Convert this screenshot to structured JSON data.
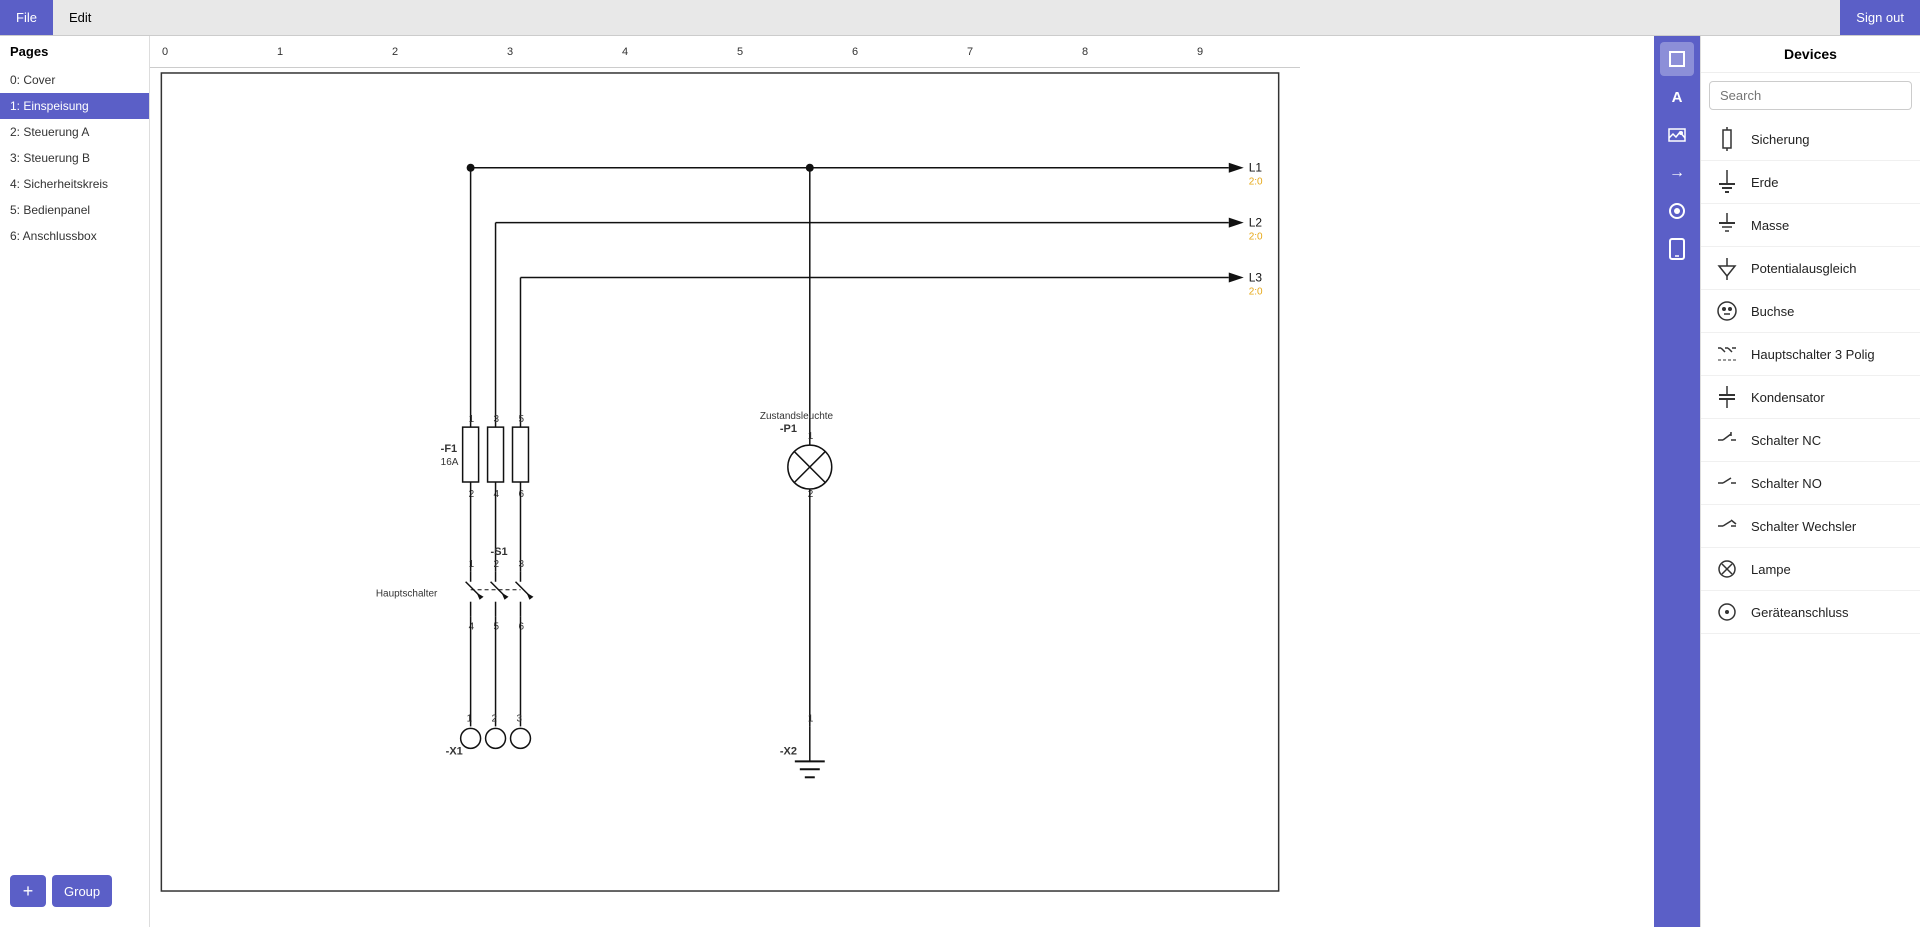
{
  "topbar": {
    "file_label": "File",
    "edit_label": "Edit",
    "sign_out_label": "Sign out"
  },
  "sidebar": {
    "title": "Pages",
    "pages": [
      {
        "id": 0,
        "label": "0: Cover",
        "active": false
      },
      {
        "id": 1,
        "label": "1: Einspeisung",
        "active": true
      },
      {
        "id": 2,
        "label": "2: Steuerung A",
        "active": false
      },
      {
        "id": 3,
        "label": "3: Steuerung B",
        "active": false
      },
      {
        "id": 4,
        "label": "4: Sicherheitskreis",
        "active": false
      },
      {
        "id": 5,
        "label": "5: Bedienpanel",
        "active": false
      },
      {
        "id": 6,
        "label": "6: Anschlussbox",
        "active": false
      }
    ],
    "add_label": "+",
    "group_label": "Group"
  },
  "toolbar": {
    "tools": [
      {
        "name": "select",
        "icon": "□"
      },
      {
        "name": "text",
        "icon": "A"
      },
      {
        "name": "image",
        "icon": "▣"
      },
      {
        "name": "arrow",
        "icon": "→"
      },
      {
        "name": "circle",
        "icon": "○"
      },
      {
        "name": "mobile",
        "icon": "▯"
      }
    ]
  },
  "devices_panel": {
    "title": "Devices",
    "search_placeholder": "Search",
    "devices": [
      {
        "name": "Sicherung",
        "icon_type": "sicherung"
      },
      {
        "name": "Erde",
        "icon_type": "erde"
      },
      {
        "name": "Masse",
        "icon_type": "masse"
      },
      {
        "name": "Potentialausgleich",
        "icon_type": "potentialausgleich"
      },
      {
        "name": "Buchse",
        "icon_type": "buchse"
      },
      {
        "name": "Hauptschalter 3 Polig",
        "icon_type": "hauptschalter"
      },
      {
        "name": "Kondensator",
        "icon_type": "kondensator"
      },
      {
        "name": "Schalter NC",
        "icon_type": "schalter_nc"
      },
      {
        "name": "Schalter NO",
        "icon_type": "schalter_no"
      },
      {
        "name": "Schalter Wechsler",
        "icon_type": "schalter_wechsler"
      },
      {
        "name": "Lampe",
        "icon_type": "lampe"
      },
      {
        "name": "Geräteanschluss",
        "icon_type": "geraeteanschluss"
      }
    ]
  },
  "schematic": {
    "ruler_marks": [
      "0",
      "1",
      "2",
      "3",
      "4",
      "5",
      "6",
      "7",
      "8",
      "9"
    ],
    "labels": {
      "L1": "L1",
      "L2": "L2",
      "L3": "L3",
      "count_L1": "2:0",
      "count_L2": "2:0",
      "count_L3": "2:0",
      "F1_label": "-F1",
      "F1_value": "16A",
      "S1_label": "-S1",
      "S1_desc": "Hauptschalter",
      "X1_label": "-X1",
      "P1_label": "-P1",
      "P1_desc": "Zustandsleuchte",
      "X2_label": "-X2"
    }
  }
}
